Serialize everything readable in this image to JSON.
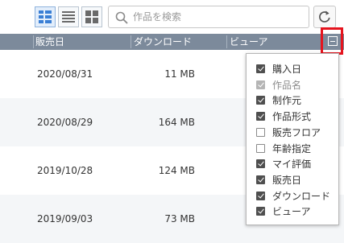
{
  "toolbar": {
    "view_buttons": [
      {
        "icon": "thumbnail-list-icon",
        "active": true
      },
      {
        "icon": "list-icon",
        "active": false
      },
      {
        "icon": "grid-icon",
        "active": false
      }
    ],
    "search_placeholder": "作品を検索",
    "refresh_icon": "refresh-icon"
  },
  "table": {
    "columns": [
      "販売日",
      "ダウンロード",
      "ビューア"
    ],
    "rows": [
      {
        "date": "2020/08/31",
        "size": "11 MB"
      },
      {
        "date": "2020/08/29",
        "size": "164 MB"
      },
      {
        "date": "2019/10/28",
        "size": "124 MB"
      },
      {
        "date": "2019/09/03",
        "size": "73 MB"
      }
    ]
  },
  "column_menu": {
    "items": [
      {
        "label": "購入日",
        "state": "checked"
      },
      {
        "label": "作品名",
        "state": "disabled"
      },
      {
        "label": "制作元",
        "state": "checked"
      },
      {
        "label": "作品形式",
        "state": "checked"
      },
      {
        "label": "販売フロア",
        "state": "unchecked"
      },
      {
        "label": "年齢指定",
        "state": "unchecked"
      },
      {
        "label": "マイ評価",
        "state": "checked"
      },
      {
        "label": "販売日",
        "state": "checked"
      },
      {
        "label": "ダウンロード",
        "state": "checked"
      },
      {
        "label": "ビューア",
        "state": "checked"
      }
    ]
  },
  "colors": {
    "header_bg": "#7c8a9b",
    "highlight_border": "#e5141e",
    "active_view_icon": "#3a7fd5"
  }
}
